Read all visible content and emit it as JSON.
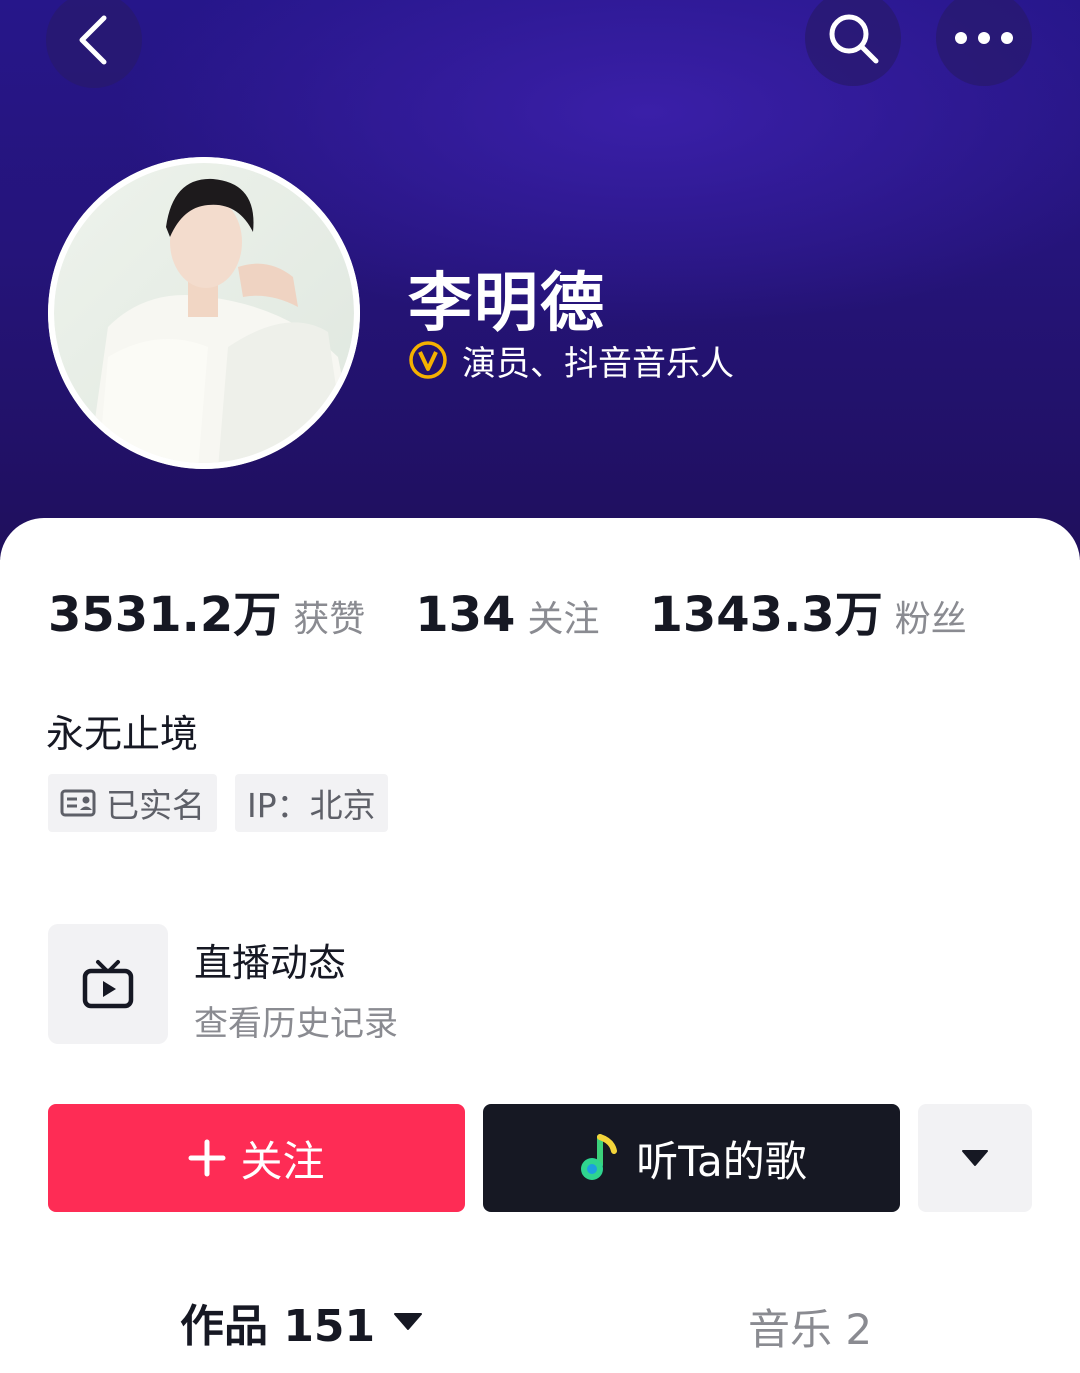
{
  "header": {
    "back_icon": "chevron-left-icon",
    "search_icon": "search-icon",
    "more_icon": "more-dots-icon"
  },
  "profile": {
    "name": "李明德",
    "verification_text": "演员、抖音音乐人",
    "verification_badge_color": "#f5b100"
  },
  "stats": [
    {
      "value": "3531.2万",
      "label": "获赞"
    },
    {
      "value": "134",
      "label": "关注"
    },
    {
      "value": "1343.3万",
      "label": "粉丝"
    }
  ],
  "bio": "永无止境",
  "tags": {
    "real_name": "已实名",
    "ip_label": "IP：北京"
  },
  "live": {
    "title": "直播动态",
    "subtitle": "查看历史记录"
  },
  "actions": {
    "follow_label": "关注",
    "follow_color": "#fe2c55",
    "song_label": "听Ta的歌",
    "song_bg": "#161823"
  },
  "tabs": {
    "works": "作品 151",
    "music": "音乐 2"
  }
}
